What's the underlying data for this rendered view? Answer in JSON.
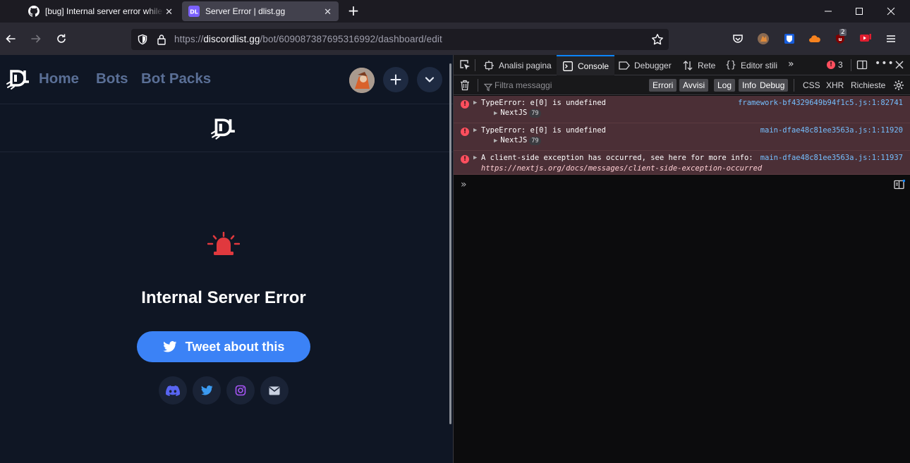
{
  "browser": {
    "tabs": [
      {
        "title": "[bug] Internal server error while",
        "favicon": "github-icon"
      },
      {
        "title": "Server Error | dlist.gg",
        "favicon": "dlist-icon",
        "active": true
      }
    ],
    "url_prefix": "https://",
    "url_host": "discordlist.gg",
    "url_path": "/bot/609087387695316992/dashboard/edit",
    "extension_badge": "2"
  },
  "site": {
    "nav": [
      "Home",
      "Bots",
      "Bot Packs"
    ],
    "error_title": "Internal Server Error",
    "tweet_label": "Tweet about this",
    "social_icons": [
      "discord-icon",
      "twitter-icon",
      "instagram-icon",
      "mail-icon"
    ],
    "colors": {
      "background": "#0f1624",
      "button": "#3b82f6",
      "alarm": "#e0393e"
    }
  },
  "devtools": {
    "tabs": [
      "Analisi pagina",
      "Console",
      "Debugger",
      "Rete",
      "Editor stili"
    ],
    "active_tab": "Console",
    "error_count": "3",
    "filter_placeholder": "Filtra messaggi",
    "level_filters": [
      "Errori",
      "Avvisi",
      "Log",
      "Info",
      "Debug"
    ],
    "type_filters": [
      "CSS",
      "XHR",
      "Richieste"
    ],
    "messages": [
      {
        "text": "TypeError: e[0] is undefined",
        "source": "framework-bf4329649b94f1c5.js:1:82741",
        "sub": "NextJS",
        "badge": "79"
      },
      {
        "text": "TypeError: e[0] is undefined",
        "source": "main-dfae48c81ee3563a.js:1:11920",
        "sub": "NextJS",
        "badge": "79"
      },
      {
        "text": "A client-side exception has occurred, see here for more info:",
        "source": "main-dfae48c81ee3563a.js:1:11937",
        "link": "https://nextjs.org/docs/messages/client-side-exception-occurred"
      }
    ]
  }
}
